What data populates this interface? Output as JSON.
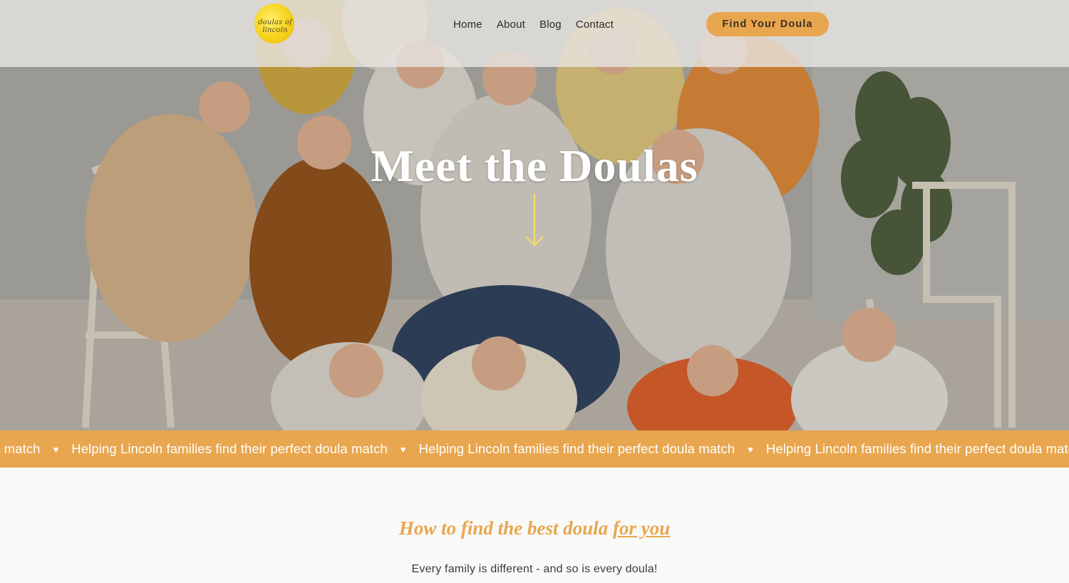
{
  "header": {
    "logo_text": "doulas of lincoln",
    "nav": [
      {
        "label": "Home"
      },
      {
        "label": "About"
      },
      {
        "label": "Blog"
      },
      {
        "label": "Contact"
      }
    ],
    "cta_label": "Find Your Doula"
  },
  "hero": {
    "title": "Meet the Doulas",
    "photo": "Group photo of smiling doulas posed with chairs and a potted plant",
    "arrow_icon": "arrow-down-icon"
  },
  "marquee": {
    "items": [
      "Helping Lincoln families find their perfect doula match",
      "Helping Lincoln families find their perfect doula match",
      "Helping Lincoln families find their perfect doula match",
      "Helping Lincoln families find their perfect doula match"
    ],
    "separator_icon": "heart-icon"
  },
  "content": {
    "heading_prefix": "How to find the best doula ",
    "heading_emphasis": "for you",
    "tagline": "Every family is different - and so is every doula!"
  },
  "colors": {
    "accent": "#e8a64f",
    "logo_yellow": "#f6d21b",
    "white": "#ffffff",
    "body_text": "#3e3b37"
  }
}
